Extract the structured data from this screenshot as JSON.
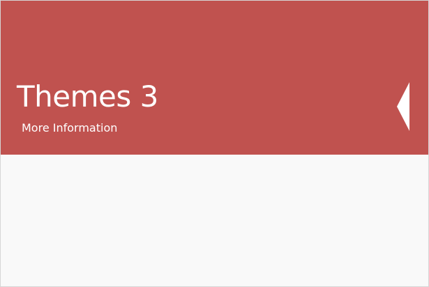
{
  "tile": {
    "title": "Themes 3",
    "link_label": "More Information",
    "toggle_icon": "triangle-left-icon",
    "colors": {
      "header_background": "#c0524f",
      "header_text": "#ffffff",
      "body_background": "#f9f9f9",
      "border": "#d6d6d6"
    }
  }
}
